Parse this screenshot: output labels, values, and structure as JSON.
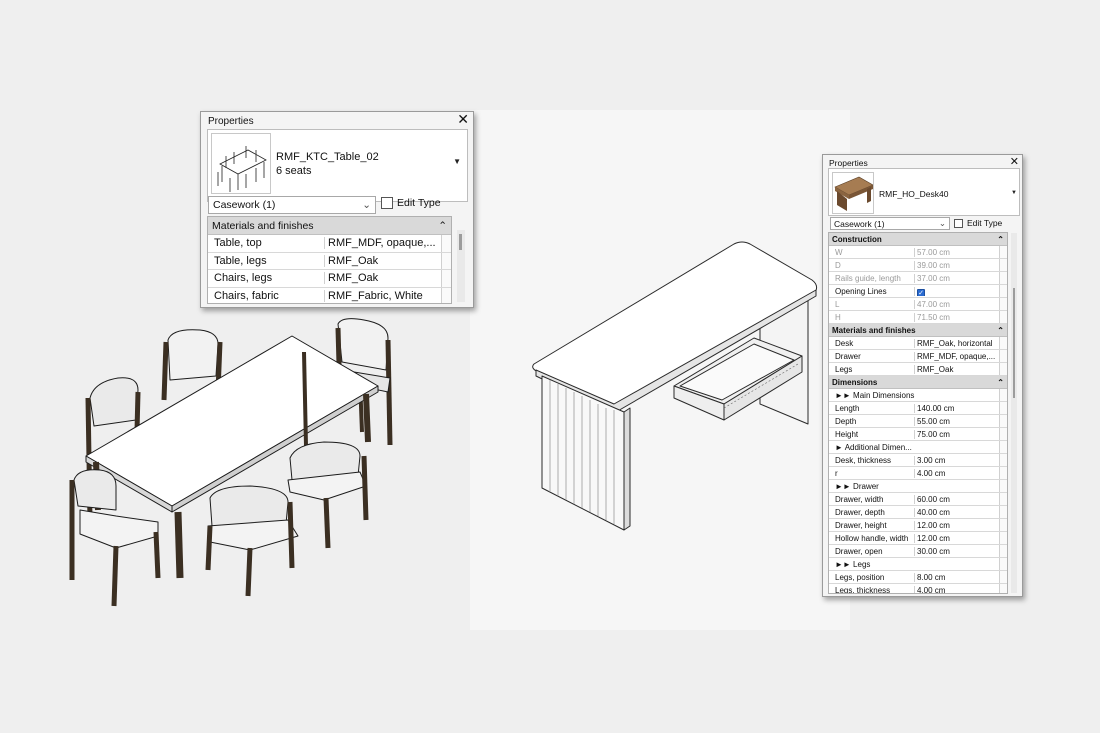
{
  "dining_panel": {
    "title": "Properties",
    "type_name": "RMF_KTC_Table_02",
    "type_subtitle": "6 seats",
    "category_value": "Casework (1)",
    "edit_type_label": "Edit Type",
    "sections": [
      {
        "label": "Materials and finishes",
        "rows": [
          {
            "name": "Table, top",
            "value": "RMF_MDF, opaque,..."
          },
          {
            "name": "Table, legs",
            "value": "RMF_Oak"
          },
          {
            "name": "Chairs, legs",
            "value": "RMF_Oak"
          },
          {
            "name": "Chairs, fabric",
            "value": "RMF_Fabric, White"
          }
        ]
      }
    ]
  },
  "desk_panel": {
    "title": "Properties",
    "type_name": "RMF_HO_Desk40",
    "category_value": "Casework (1)",
    "edit_type_label": "Edit Type",
    "sections": [
      {
        "label": "Construction",
        "rows": [
          {
            "name": "W",
            "value": "57.00 cm",
            "dim": true
          },
          {
            "name": "D",
            "value": "39.00 cm",
            "dim": true
          },
          {
            "name": "Rails guide, length",
            "value": "37.00 cm",
            "dim": true
          },
          {
            "name": "Opening Lines",
            "value": "",
            "checkbox": true,
            "checked": true
          },
          {
            "name": "L",
            "value": "47.00 cm",
            "dim": true
          },
          {
            "name": "H",
            "value": "71.50 cm",
            "dim": true
          }
        ]
      },
      {
        "label": "Materials and finishes",
        "rows": [
          {
            "name": "Desk",
            "value": "RMF_Oak, horizontal"
          },
          {
            "name": "Drawer",
            "value": "RMF_MDF, opaque,..."
          },
          {
            "name": "Legs",
            "value": "RMF_Oak"
          }
        ]
      },
      {
        "label": "Dimensions",
        "rows": [
          {
            "name": "►► Main Dimensions",
            "value": "",
            "group": true
          },
          {
            "name": "Length",
            "value": "140.00 cm"
          },
          {
            "name": "Depth",
            "value": "55.00 cm"
          },
          {
            "name": "Height",
            "value": "75.00 cm"
          },
          {
            "name": "► Additional Dimen...",
            "value": "",
            "group": true
          },
          {
            "name": "Desk, thickness",
            "value": "3.00 cm"
          },
          {
            "name": "r",
            "value": "4.00 cm"
          },
          {
            "name": "►► Drawer",
            "value": "",
            "group": true
          },
          {
            "name": "Drawer, width",
            "value": "60.00 cm"
          },
          {
            "name": "Drawer, depth",
            "value": "40.00 cm"
          },
          {
            "name": "Drawer, height",
            "value": "12.00 cm"
          },
          {
            "name": "Hollow handle, width",
            "value": "12.00 cm"
          },
          {
            "name": "Drawer, open",
            "value": "30.00 cm"
          },
          {
            "name": "►► Legs",
            "value": "",
            "group": true
          },
          {
            "name": "Legs, position",
            "value": "8.00 cm"
          },
          {
            "name": "Legs, thickness",
            "value": "4.00 cm"
          }
        ]
      }
    ]
  },
  "colors": {
    "background": "#efefef",
    "panel": "#f4f4f4",
    "section_header": "#d9d9d9",
    "oak": "#5b4a37",
    "checkbox_blue": "#2a6bd1"
  },
  "icons": {
    "close": "close-icon",
    "dropdown": "chevron-down-icon",
    "edit_type": "edit-type-icon",
    "collapse": "collapse-icon"
  }
}
